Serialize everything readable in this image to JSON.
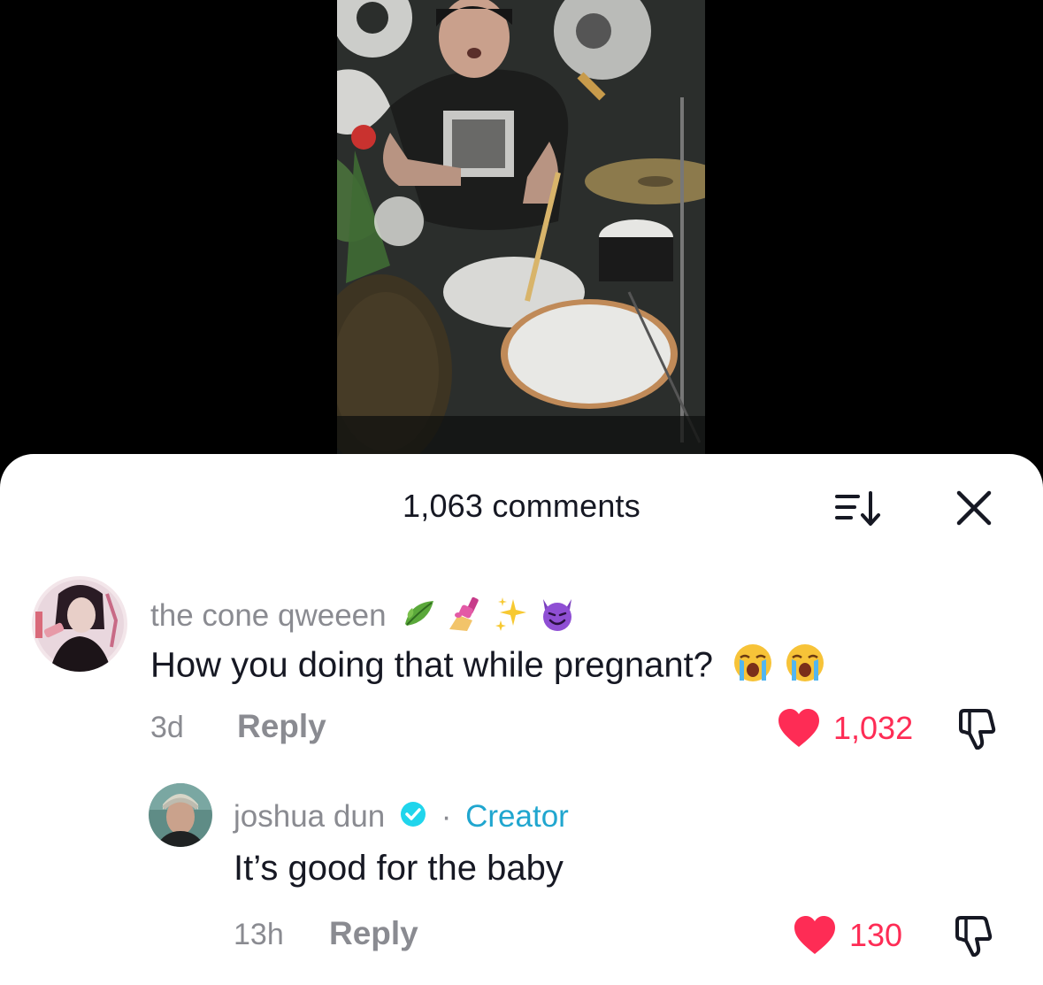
{
  "header": {
    "comments_count": "1,063 comments"
  },
  "comments": [
    {
      "username": "the cone qweeen",
      "username_emojis": [
        "leaf-emoji",
        "nail-polish-emoji",
        "sparkles-emoji",
        "smiling-devil-emoji"
      ],
      "text": "How you doing that while pregnant?",
      "text_emojis": [
        "loudly-crying-emoji",
        "loudly-crying-emoji"
      ],
      "time": "3d",
      "reply_label": "Reply",
      "likes": "1,032",
      "liked": true
    },
    {
      "username": "joshua dun",
      "verified": true,
      "badge_separator": "·",
      "badge": "Creator",
      "text": "It’s good for the baby",
      "time": "13h",
      "reply_label": "Reply",
      "likes": "130",
      "liked": true
    }
  ],
  "colors": {
    "like": "#fe2c55",
    "creator": "#20a6cf",
    "verified": "#20d5ec",
    "secondary_text": "#8a8b91",
    "primary_text": "#161823"
  }
}
